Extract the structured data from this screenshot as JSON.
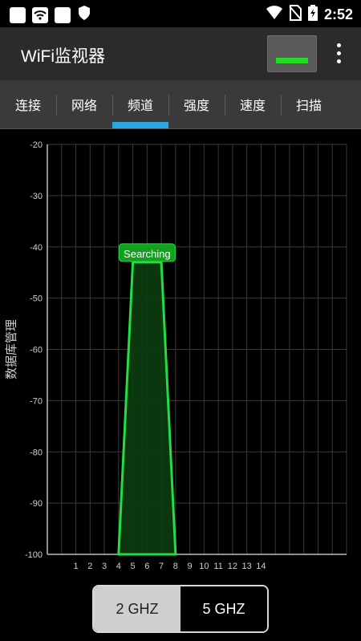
{
  "status": {
    "time": "2:52"
  },
  "app": {
    "title": "WiFi监视器"
  },
  "tabs": [
    {
      "label": "连接"
    },
    {
      "label": "网络"
    },
    {
      "label": "频道",
      "active": true
    },
    {
      "label": "强度"
    },
    {
      "label": "速度"
    },
    {
      "label": "扫描"
    }
  ],
  "band_toggle": {
    "options": [
      "2 GHZ",
      "5 GHZ"
    ],
    "selected": "2 GHZ"
  },
  "chart_data": {
    "type": "area",
    "ylabel": "数据库管理",
    "ylim": [
      -100,
      -20
    ],
    "y_ticks": [
      -20,
      -30,
      -40,
      -50,
      -60,
      -70,
      -80,
      -90,
      -100
    ],
    "x_ticks": [
      "1",
      "2",
      "3",
      "4",
      "5",
      "6",
      "7",
      "8",
      "9",
      "10",
      "11",
      "12",
      "13",
      "14"
    ],
    "series": [
      {
        "name": "Searching",
        "channel": 6,
        "signal_dbm": -43,
        "points": [
          [
            4,
            -100
          ],
          [
            5,
            -43
          ],
          [
            7,
            -43
          ],
          [
            8,
            -100
          ]
        ],
        "color": "#22dd44"
      }
    ],
    "grid": true,
    "colors": {
      "grid": "#3a3a3a",
      "series_fill": "#0b3d10",
      "series_stroke": "#22dd44"
    }
  }
}
